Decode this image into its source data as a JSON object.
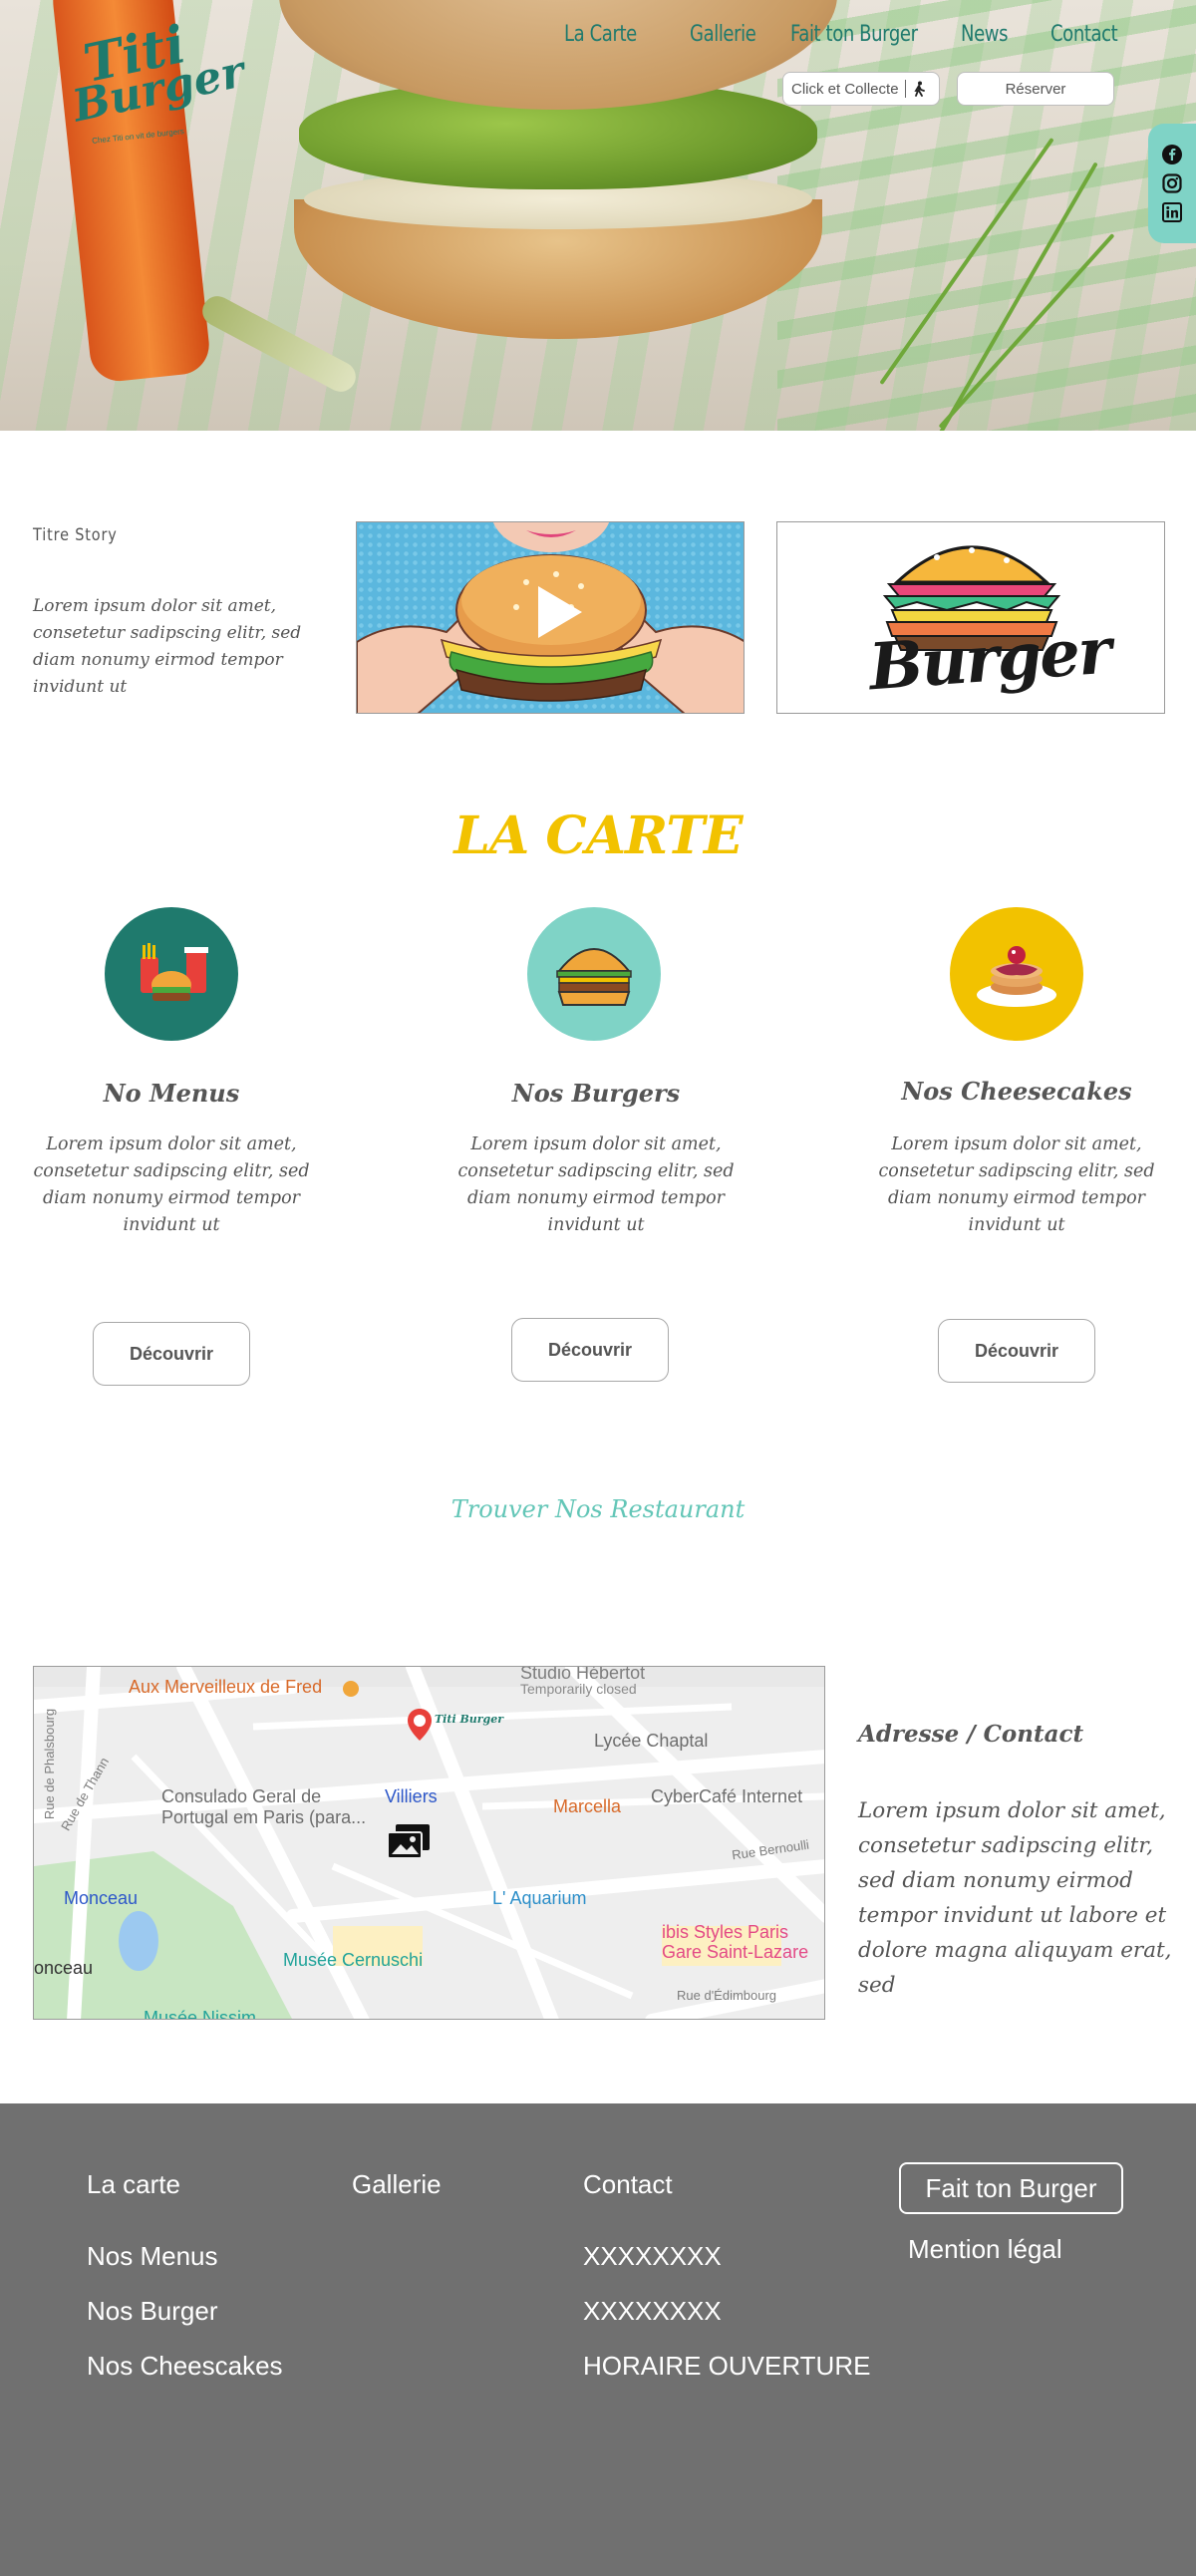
{
  "header": {
    "logo": {
      "line1": "Titi",
      "line2": "Burger",
      "tagline": "Chez Titi on vit de burgers"
    },
    "nav": [
      "La Carte",
      "Gallerie",
      "Fait ton Burger",
      "News",
      "Contact"
    ],
    "click_collect_label": "Click et Collecte",
    "reserve_label": "Réserver",
    "social": [
      "facebook-icon",
      "instagram-icon",
      "linkedin-icon"
    ]
  },
  "story": {
    "title": "Titre Story",
    "text": "Lorem ipsum dolor sit amet, consetetur sadipscing elitr, sed diam nonumy eirmod tempor invidunt ut",
    "logo_text": "Burger"
  },
  "carte": {
    "title": "LA CARTE",
    "cards": [
      {
        "title": "No Menus",
        "text": "Lorem ipsum dolor sit amet, consetetur sadipscing elitr, sed diam nonumy eirmod tempor invidunt ut",
        "button": "Découvrir",
        "color": "#1f7a6d"
      },
      {
        "title": "Nos Burgers",
        "text": "Lorem ipsum dolor sit amet, consetetur sadipscing elitr, sed diam nonumy eirmod tempor invidunt ut",
        "button": "Découvrir",
        "color": "#7fd3c6"
      },
      {
        "title": "Nos Cheesecakes",
        "text": "Lorem ipsum dolor sit amet, consetetur sadipscing elitr, sed diam nonumy eirmod tempor invidunt ut",
        "button": "Découvrir",
        "color": "#f2c200"
      }
    ]
  },
  "find": {
    "title": "Trouver Nos Restaurant"
  },
  "map": {
    "labels": {
      "l1": "Aux Merveilleux de Fred",
      "l2": "Studio Hébertot",
      "l3": "Temporarily closed",
      "l4": "Lycée Chaptal",
      "l5": "Consulado Geral de",
      "l6": "Portugal em Paris (para...",
      "l7": "Villiers",
      "l8": "Marcella",
      "l9": "CyberCafé Internet",
      "l10": "Rue Bernoulli",
      "l11": "Monceau",
      "l12": "L' Aquarium",
      "l13": "ibis Styles Paris",
      "l14": "Gare Saint-Lazare",
      "l15": "Musée Cernuschi",
      "l16": "onceau",
      "l17": "Rue d'Édimbourg",
      "l18": "Rue de Phalsbourg",
      "l19": "Rue de Thann",
      "l20": "Musée Nissim",
      "pin": "Titi Burger"
    }
  },
  "contact": {
    "title": "Adresse / Contact",
    "text": "Lorem ipsum dolor sit amet, consetetur sadipscing elitr, sed diam nonumy eirmod tempor invidunt ut labore et dolore magna aliquyam erat, sed"
  },
  "footer": {
    "col1": [
      "La carte",
      "Nos Menus",
      "Nos Burger",
      "Nos Cheescakes"
    ],
    "col2": [
      "Gallerie"
    ],
    "col3": [
      "Contact",
      "XXXXXXXX",
      "XXXXXXXX",
      "HORAIRE OUVERTURE"
    ],
    "col4": [
      "Fait ton Burger",
      "Mention légal"
    ]
  }
}
